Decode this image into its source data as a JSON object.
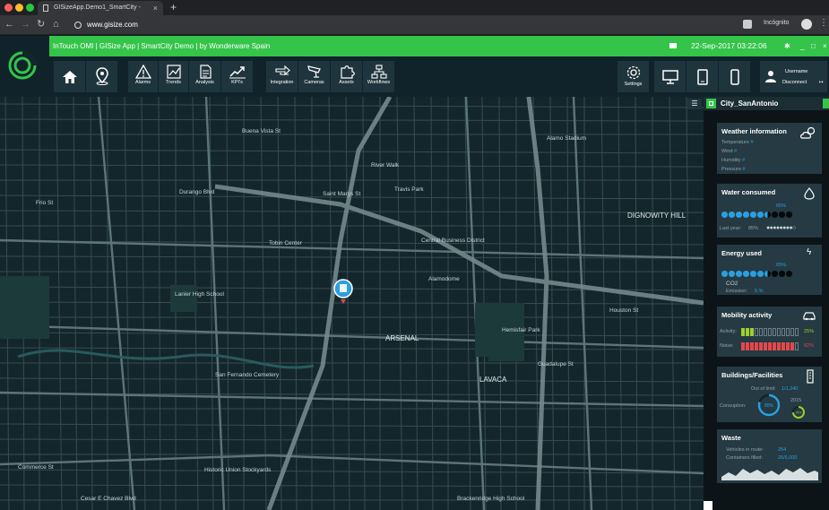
{
  "browser": {
    "tab_title": "GISizeApp.Demo1_SmartCity -",
    "url": "www.gisize.com",
    "incognito_label": "Incógnito"
  },
  "app": {
    "title": "InTouch OMI | GISize App | SmartCity Demo | by Wonderware Spain",
    "datetime": "22-Sep-2017 03:22:06"
  },
  "toolbar": {
    "groups": [
      {
        "label": "Alarms"
      },
      {
        "label": "Trends"
      },
      {
        "label": "Analysis"
      },
      {
        "label": "KPI's"
      }
    ],
    "groups2": [
      {
        "label": "Integration"
      },
      {
        "label": "Cameras"
      },
      {
        "label": "Assets"
      },
      {
        "label": "Workflows"
      }
    ],
    "settings_label": "Settings",
    "username": "Username",
    "disconnect": "Disconnect"
  },
  "map": {
    "labels": [
      {
        "text": "ARSENAL"
      },
      {
        "text": "LAVACA"
      },
      {
        "text": "DIGNOWITY HILL"
      },
      {
        "text": "Central Business District"
      },
      {
        "text": "Hemisfair Park"
      },
      {
        "text": "Lanier High School"
      },
      {
        "text": "Alamo Stadium"
      },
      {
        "text": "San Fernando Cemetery"
      },
      {
        "text": "Historic Union Stockyards"
      },
      {
        "text": "Brackenridge High School"
      },
      {
        "text": "Alamodome"
      },
      {
        "text": "River Walk"
      },
      {
        "text": "Travis Park"
      },
      {
        "text": "Tobin Center"
      },
      {
        "text": "Commerce St"
      },
      {
        "text": "Durango Blvd"
      },
      {
        "text": "Frio St"
      },
      {
        "text": "Guadalupe St"
      },
      {
        "text": "Buena Vista St"
      },
      {
        "text": "Houston St"
      },
      {
        "text": "Cesar E Chavez Blvd"
      },
      {
        "text": "Saint Marys St"
      }
    ]
  },
  "panel": {
    "city": "City_SanAntonio",
    "weather": {
      "title": "Weather information",
      "rows": [
        {
          "label": "Temperature",
          "value": "#"
        },
        {
          "label": "Wind",
          "value": "#"
        },
        {
          "label": "Humidity",
          "value": "#"
        },
        {
          "label": "Pressure",
          "value": "#"
        }
      ]
    },
    "water": {
      "title": "Water consumed",
      "percent": "65%",
      "filled": 6.5,
      "lastyear_label": "Last year:",
      "lastyear_value": "85%"
    },
    "energy": {
      "title": "Energy used",
      "percent": "65%",
      "filled": 6.5,
      "co2_label": "CO2",
      "emission_label": "Emission:",
      "emission_value": "5 %"
    },
    "mobility": {
      "title": "Mobility activity",
      "activity_label": "Activity:",
      "activity_value": "25%",
      "activity_fraction": 0.25,
      "noise_label": "Noise:",
      "noise_value": "92%",
      "noise_fraction": 0.92
    },
    "buildings": {
      "title": "Buildings/Facilities",
      "outoflimit_label": "Out of limit:",
      "outoflimit_value": "1/1,240",
      "consumption_label": "Consuption:",
      "gauge_value": "80%",
      "year": "2015",
      "year_gauge_value": "75%"
    },
    "waste": {
      "title": "Waste",
      "vehicles_label": "Vehicles in route:",
      "vehicles_value": "254",
      "containers_label": "Containers filled:",
      "containers_value": "26/6,000"
    }
  },
  "colors": {
    "accent_green": "#35c44a",
    "blue": "#2b9fe0",
    "red": "#e7474a",
    "lime": "#9ed12b"
  }
}
